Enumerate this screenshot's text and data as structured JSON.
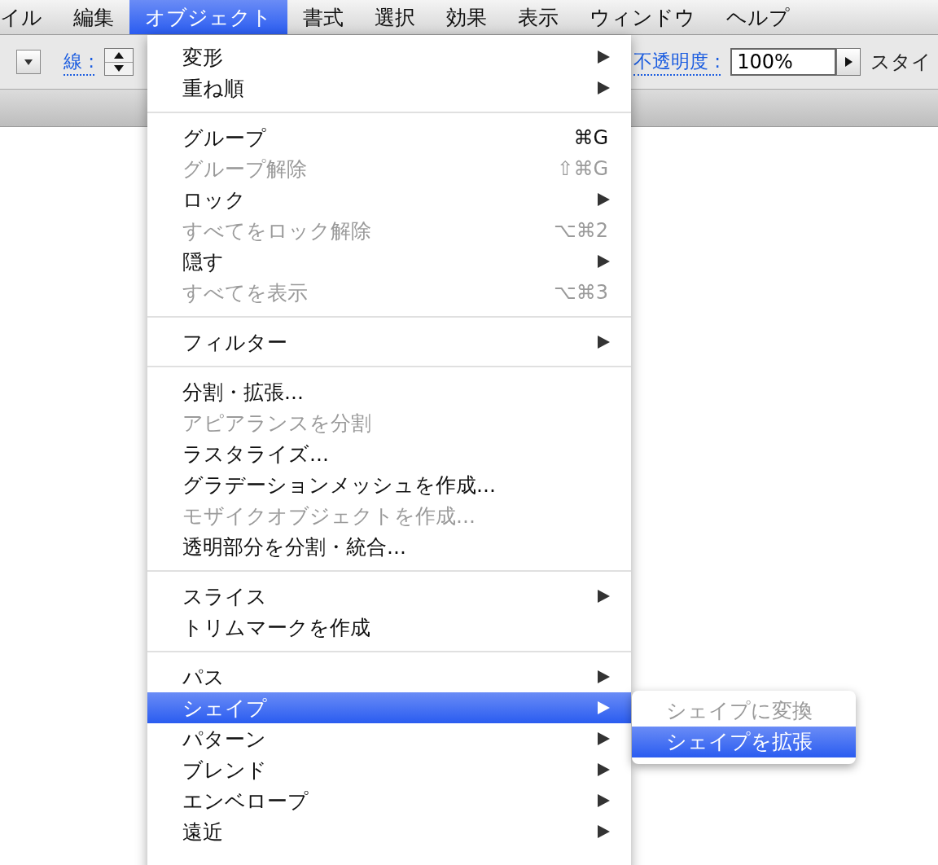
{
  "menubar": [
    {
      "label": "イル",
      "selected": false
    },
    {
      "label": "編集",
      "selected": false
    },
    {
      "label": "オブジェクト",
      "selected": true
    },
    {
      "label": "書式",
      "selected": false
    },
    {
      "label": "選択",
      "selected": false
    },
    {
      "label": "効果",
      "selected": false
    },
    {
      "label": "表示",
      "selected": false
    },
    {
      "label": "ウィンドウ",
      "selected": false
    },
    {
      "label": "ヘルプ",
      "selected": false
    }
  ],
  "toolbar": {
    "stroke_label": "線 :",
    "opacity_label": "不透明度 :",
    "opacity_value": "100%",
    "style_label": "スタイ"
  },
  "menu": [
    {
      "kind": "item",
      "label": "変形",
      "submenu": true,
      "disabled": false,
      "selected": false
    },
    {
      "kind": "item",
      "label": "重ね順",
      "submenu": true,
      "disabled": false,
      "selected": false
    },
    {
      "kind": "separator"
    },
    {
      "kind": "item",
      "label": "グループ",
      "shortcut": "⌘G",
      "disabled": false,
      "selected": false
    },
    {
      "kind": "item",
      "label": "グループ解除",
      "shortcut": "⇧⌘G",
      "disabled": true,
      "selected": false
    },
    {
      "kind": "item",
      "label": "ロック",
      "submenu": true,
      "disabled": false,
      "selected": false
    },
    {
      "kind": "item",
      "label": "すべてをロック解除",
      "shortcut": "⌥⌘2",
      "disabled": true,
      "selected": false
    },
    {
      "kind": "item",
      "label": "隠す",
      "submenu": true,
      "disabled": false,
      "selected": false
    },
    {
      "kind": "item",
      "label": "すべてを表示",
      "shortcut": "⌥⌘3",
      "disabled": true,
      "selected": false
    },
    {
      "kind": "separator"
    },
    {
      "kind": "item",
      "label": "フィルター",
      "submenu": true,
      "disabled": false,
      "selected": false
    },
    {
      "kind": "separator"
    },
    {
      "kind": "item",
      "label": "分割・拡張...",
      "disabled": false,
      "selected": false
    },
    {
      "kind": "item",
      "label": "アピアランスを分割",
      "disabled": true,
      "selected": false
    },
    {
      "kind": "item",
      "label": "ラスタライズ...",
      "disabled": false,
      "selected": false
    },
    {
      "kind": "item",
      "label": "グラデーションメッシュを作成...",
      "disabled": false,
      "selected": false
    },
    {
      "kind": "item",
      "label": "モザイクオブジェクトを作成...",
      "disabled": true,
      "selected": false
    },
    {
      "kind": "item",
      "label": "透明部分を分割・統合...",
      "disabled": false,
      "selected": false
    },
    {
      "kind": "separator"
    },
    {
      "kind": "item",
      "label": "スライス",
      "submenu": true,
      "disabled": false,
      "selected": false
    },
    {
      "kind": "item",
      "label": "トリムマークを作成",
      "disabled": false,
      "selected": false
    },
    {
      "kind": "separator"
    },
    {
      "kind": "item",
      "label": "パス",
      "submenu": true,
      "disabled": false,
      "selected": false
    },
    {
      "kind": "item",
      "label": "シェイプ",
      "submenu": true,
      "disabled": false,
      "selected": true
    },
    {
      "kind": "item",
      "label": "パターン",
      "submenu": true,
      "disabled": false,
      "selected": false
    },
    {
      "kind": "item",
      "label": "ブレンド",
      "submenu": true,
      "disabled": false,
      "selected": false
    },
    {
      "kind": "item",
      "label": "エンベロープ",
      "submenu": true,
      "disabled": false,
      "selected": false
    },
    {
      "kind": "item",
      "label": "遠近",
      "submenu": true,
      "disabled": false,
      "selected": false
    }
  ],
  "submenu": [
    {
      "label": "シェイプに変換",
      "disabled": true,
      "selected": false
    },
    {
      "label": "シェイプを拡張",
      "disabled": false,
      "selected": true
    }
  ]
}
